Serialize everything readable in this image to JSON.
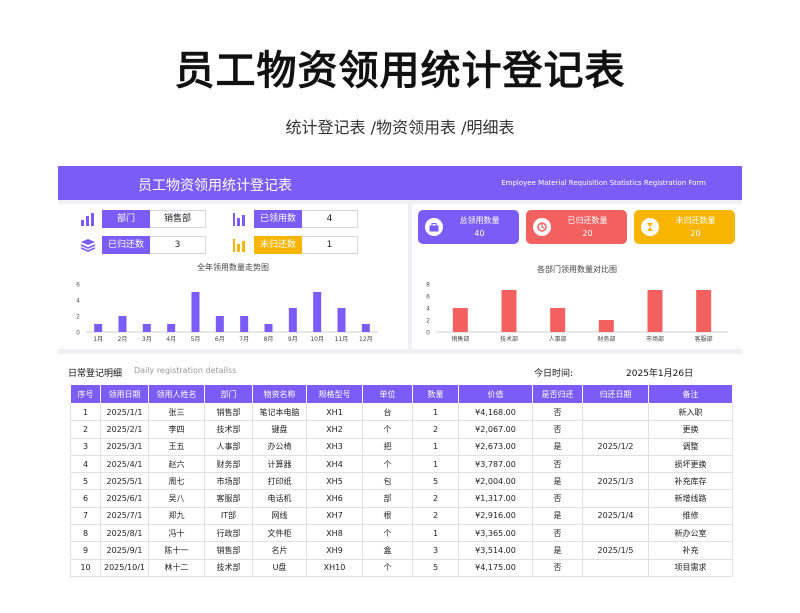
{
  "page": {
    "title": "员工物资领用统计登记表",
    "subtitle": "统计登记表 /物资领用表 /明细表"
  },
  "banner": {
    "title": "员工物资领用统计登记表",
    "subtitle_en": "Employee Material Requisition Statistics Registration Form"
  },
  "summary": {
    "department_label": "部门",
    "department_value": "销售部",
    "used_label": "已领用数",
    "used_value": "4",
    "returned_label": "已归还数",
    "returned_value": "3",
    "not_returned_label": "未归还数",
    "not_returned_value": "1"
  },
  "stats": [
    {
      "label": "总领用数量",
      "value": "40",
      "color": "#7c5cf6",
      "icon": "briefcase-icon"
    },
    {
      "label": "已归还数量",
      "value": "20",
      "color": "#f36060",
      "icon": "return-icon"
    },
    {
      "label": "未归还数量",
      "value": "20",
      "color": "#f7b500",
      "icon": "clock-icon"
    }
  ],
  "chart_data": [
    {
      "type": "bar",
      "title": "全年领用数量走势图",
      "categories": [
        "1月",
        "2月",
        "3月",
        "4月",
        "5月",
        "6月",
        "7月",
        "8月",
        "9月",
        "10月",
        "11月",
        "12月"
      ],
      "values": [
        1,
        2,
        1,
        1,
        5,
        2,
        2,
        1,
        3,
        5,
        3,
        1
      ],
      "ylim": [
        0,
        6
      ],
      "yticks": [
        0,
        2,
        4,
        6
      ],
      "color": "#7c5cf6",
      "grid": false
    },
    {
      "type": "bar",
      "title": "各部门领用数量对比图",
      "categories": [
        "销售部",
        "技术部",
        "人事部",
        "财务部",
        "市场部",
        "客服部"
      ],
      "values": [
        4,
        7,
        4,
        2,
        7,
        7
      ],
      "ylim": [
        0,
        8
      ],
      "yticks": [
        0,
        2,
        4,
        6,
        8
      ],
      "color": "#f36060",
      "grid": false
    }
  ],
  "table": {
    "heading": "日常登记明细",
    "heading_en": "Daily registration detailss",
    "date_label": "今日时间:",
    "date_value": "2025年1月26日",
    "columns": [
      "序号",
      "领用日期",
      "领用人姓名",
      "部门",
      "物资名称",
      "规格型号",
      "单位",
      "数量",
      "价值",
      "是否归还",
      "归还日期",
      "备注"
    ],
    "rows": [
      [
        "1",
        "2025/1/1",
        "张三",
        "销售部",
        "笔记本电脑",
        "XH1",
        "台",
        "1",
        "¥4,168.00",
        "否",
        "",
        "新入职"
      ],
      [
        "2",
        "2025/2/1",
        "李四",
        "技术部",
        "键盘",
        "XH2",
        "个",
        "2",
        "¥2,067.00",
        "否",
        "",
        "更换"
      ],
      [
        "3",
        "2025/3/1",
        "王五",
        "人事部",
        "办公椅",
        "XH3",
        "把",
        "1",
        "¥2,673.00",
        "是",
        "2025/1/2",
        "调整"
      ],
      [
        "4",
        "2025/4/1",
        "赵六",
        "财务部",
        "计算器",
        "XH4",
        "个",
        "1",
        "¥3,787.00",
        "否",
        "",
        "损坏更换"
      ],
      [
        "5",
        "2025/5/1",
        "周七",
        "市场部",
        "打印纸",
        "XH5",
        "包",
        "5",
        "¥2,004.00",
        "是",
        "2025/1/3",
        "补充库存"
      ],
      [
        "6",
        "2025/6/1",
        "吴八",
        "客服部",
        "电话机",
        "XH6",
        "部",
        "2",
        "¥1,317.00",
        "否",
        "",
        "新增线路"
      ],
      [
        "7",
        "2025/7/1",
        "郑九",
        "IT部",
        "网线",
        "XH7",
        "根",
        "2",
        "¥2,916.00",
        "是",
        "2025/1/4",
        "维修"
      ],
      [
        "8",
        "2025/8/1",
        "冯十",
        "行政部",
        "文件柜",
        "XH8",
        "个",
        "1",
        "¥3,365.00",
        "否",
        "",
        "新办公室"
      ],
      [
        "9",
        "2025/9/1",
        "陈十一",
        "销售部",
        "名片",
        "XH9",
        "盒",
        "3",
        "¥3,514.00",
        "是",
        "2025/1/5",
        "补充"
      ],
      [
        "10",
        "2025/10/1",
        "林十二",
        "技术部",
        "U盘",
        "XH10",
        "个",
        "5",
        "¥4,175.00",
        "否",
        "",
        "项目需求"
      ]
    ]
  }
}
